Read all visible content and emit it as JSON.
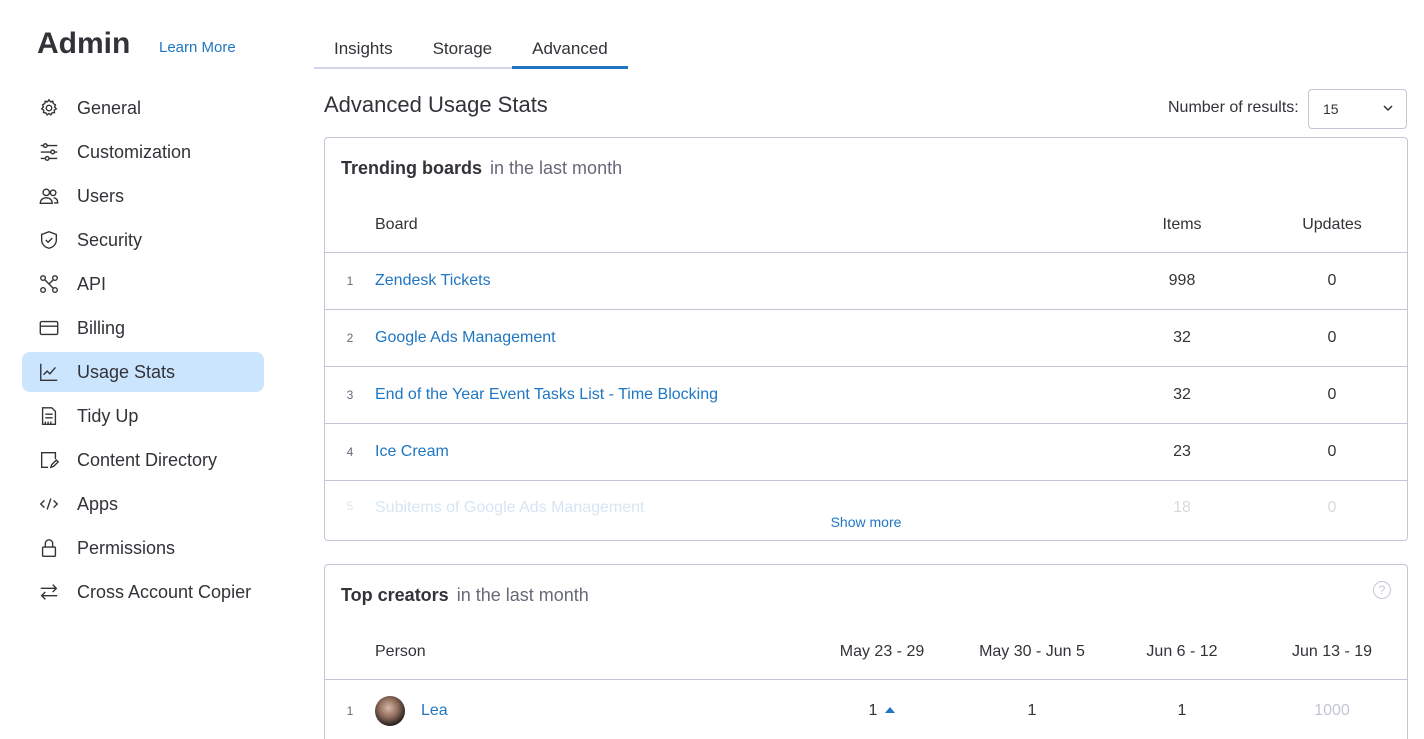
{
  "sidebar": {
    "title": "Admin",
    "learn_more": "Learn More",
    "items": [
      {
        "label": "General",
        "icon": "gear-icon"
      },
      {
        "label": "Customization",
        "icon": "sliders-icon"
      },
      {
        "label": "Users",
        "icon": "users-icon"
      },
      {
        "label": "Security",
        "icon": "shield-icon"
      },
      {
        "label": "API",
        "icon": "api-icon"
      },
      {
        "label": "Billing",
        "icon": "credit-card-icon"
      },
      {
        "label": "Usage Stats",
        "icon": "chart-line-icon",
        "active": true
      },
      {
        "label": "Tidy Up",
        "icon": "broom-icon"
      },
      {
        "label": "Content Directory",
        "icon": "document-edit-icon"
      },
      {
        "label": "Apps",
        "icon": "code-icon"
      },
      {
        "label": "Permissions",
        "icon": "lock-icon"
      },
      {
        "label": "Cross Account Copier",
        "icon": "arrows-swap-icon"
      }
    ]
  },
  "tabs": [
    {
      "label": "Insights"
    },
    {
      "label": "Storage"
    },
    {
      "label": "Advanced",
      "active": true
    }
  ],
  "main": {
    "title": "Advanced Usage Stats",
    "results_label": "Number of results:",
    "results_value": "15"
  },
  "trending": {
    "title": "Trending boards",
    "subtitle": "in the last month",
    "columns": {
      "board": "Board",
      "items": "Items",
      "updates": "Updates"
    },
    "rows": [
      {
        "index": "1",
        "board": "Zendesk Tickets",
        "items": "998",
        "updates": "0"
      },
      {
        "index": "2",
        "board": "Google Ads Management",
        "items": "32",
        "updates": "0"
      },
      {
        "index": "3",
        "board": "End of the Year Event Tasks List - Time Blocking",
        "items": "32",
        "updates": "0"
      },
      {
        "index": "4",
        "board": "Ice Cream",
        "items": "23",
        "updates": "0"
      },
      {
        "index": "5",
        "board": "Subitems of Google Ads Management",
        "items": "18",
        "updates": "0"
      }
    ],
    "show_more": "Show more"
  },
  "creators": {
    "title": "Top creators",
    "subtitle": "in the last month",
    "help": "?",
    "columns": {
      "person": "Person",
      "w1": "May 23 - 29",
      "w2": "May 30 - Jun 5",
      "w3": "Jun 6 - 12",
      "w4": "Jun 13 - 19"
    },
    "rows": [
      {
        "index": "1",
        "person": "Lea",
        "w1": "1",
        "w2": "1",
        "w3": "1",
        "w4": "1000"
      }
    ]
  }
}
